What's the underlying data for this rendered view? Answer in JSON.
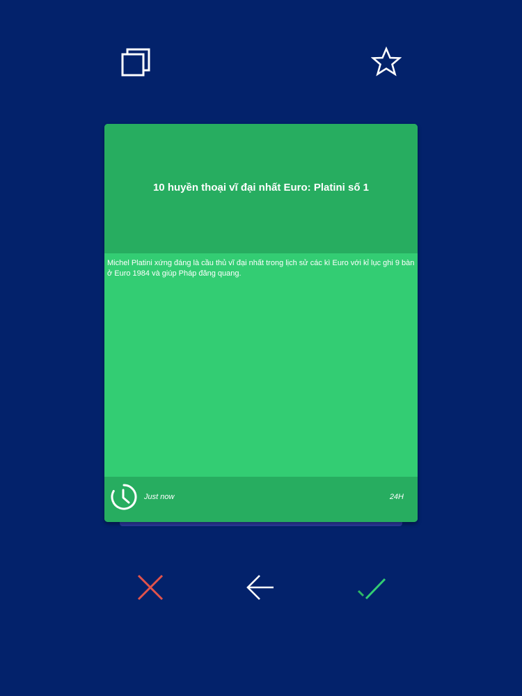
{
  "toolbar": {
    "copy_icon": "copy-icon",
    "star_icon": "star-outline-icon"
  },
  "card": {
    "title": "10 huyền thoại vĩ đại nhất Euro: Platini số 1",
    "description": "Michel Platini xứng đáng là cầu thủ vĩ đại nhất trong lịch sử các kì Euro với kỉ lục ghi 9 bàn ở Euro 1984 và giúp Pháp đăng quang.",
    "time": "Just now",
    "duration": "24H",
    "header_color": "#27ad60",
    "body_color": "#33cd73"
  },
  "actions": {
    "reject_icon": "close-icon",
    "back_icon": "arrow-left-icon",
    "accept_icon": "check-icon",
    "reject_color": "#e2534b",
    "accept_color": "#33cd73"
  },
  "colors": {
    "background": "#03226b"
  }
}
